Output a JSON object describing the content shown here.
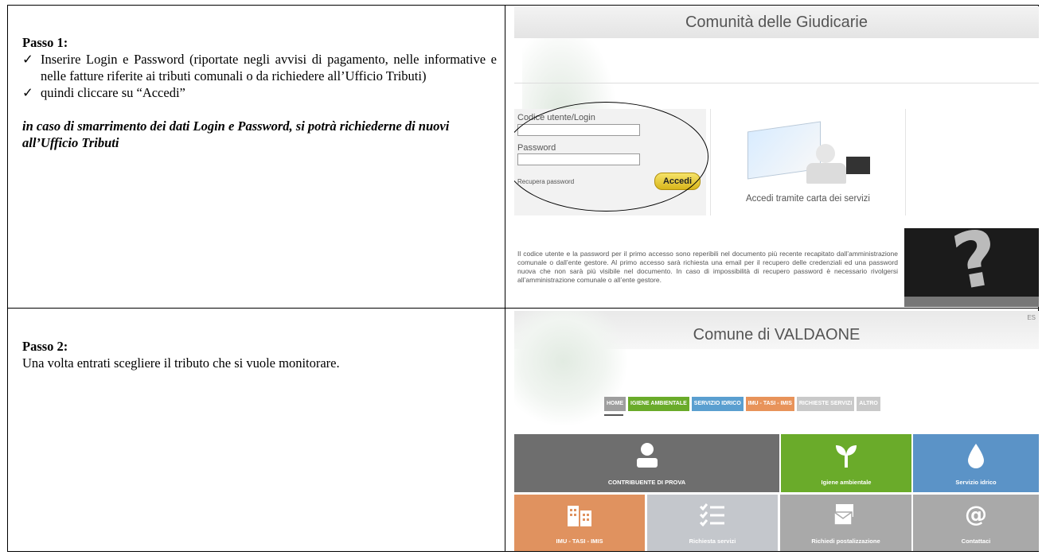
{
  "row1": {
    "step_label": "Passo 1:",
    "check_symbol": "✓",
    "bullets": [
      "Inserire Login e Password (riportate negli avvisi di pagamento, nelle informative e nelle fatture riferite ai tributi comunali o da richiedere all’Ufficio Tributi)",
      "quindi cliccare su “Accedi”"
    ],
    "note": "in caso di smarrimento dei dati Login e Password, si potrà richiederne di nuovi all’Ufficio Tributi"
  },
  "row2": {
    "step_label": "Passo 2:",
    "text": "Una volta entrati scegliere il tributo che si vuole monitorare."
  },
  "login_screen": {
    "title": "Comunità delle Giudicarie",
    "username_label": "Codice utente/Login",
    "password_label": "Password",
    "recover_link": "Recupera password",
    "login_button": "Accedi",
    "card_caption": "Accedi tramite carta dei servizi",
    "info_text": "Il codice utente e la password per il primo accesso sono reperibili nel documento più recente recapitato dall’amministrazione comunale o dall’ente gestore. Al primo accesso sarà richiesta una email per il recupero delle credenziali ed una password nuova che non sarà più visibile nel documento. In caso di impossibilità di recupero password è necessario rivolgersi all’amministrazione comunale o all’ente gestore.",
    "colors": {
      "button": "#e3c431",
      "question_bg": "#1b1b1b"
    }
  },
  "dashboard": {
    "title": "Comune di VALDAONE",
    "corner_text": "ES",
    "nav": [
      {
        "label": "HOME",
        "color": "#9e9e9e"
      },
      {
        "label": "IGIENE AMBIENTALE",
        "color": "#6aab2a"
      },
      {
        "label": "SERVIZIO IDRICO",
        "color": "#5a9fd0"
      },
      {
        "label": "IMU - TASI - IMIS",
        "color": "#e8935a"
      },
      {
        "label": "RICHIESTE SERVIZI",
        "color": "#c9c9c9"
      },
      {
        "label": "ALTRO",
        "color": "#c9c9c9"
      }
    ],
    "tiles": [
      {
        "label": "CONTRIBUENTE DI PROVA",
        "icon": "user-icon",
        "color": "#6e6e6e"
      },
      {
        "label": "Igiene ambientale",
        "icon": "sprout-icon",
        "color": "#6aab2a"
      },
      {
        "label": "Servizio idrico",
        "icon": "water-drop-icon",
        "color": "#5b93c7"
      },
      {
        "label": "IMU - TASI - IMIS",
        "icon": "buildings-icon",
        "color": "#e0925f"
      },
      {
        "label": "Richiesta servizi",
        "icon": "checklist-icon",
        "color": "#c4c7cc"
      },
      {
        "label": "Richiedi postalizzazione",
        "icon": "mail-icon",
        "color": "#a9a9a9"
      },
      {
        "label": "Contattaci",
        "icon": "at-icon",
        "color": "#a9a9a9"
      }
    ]
  }
}
